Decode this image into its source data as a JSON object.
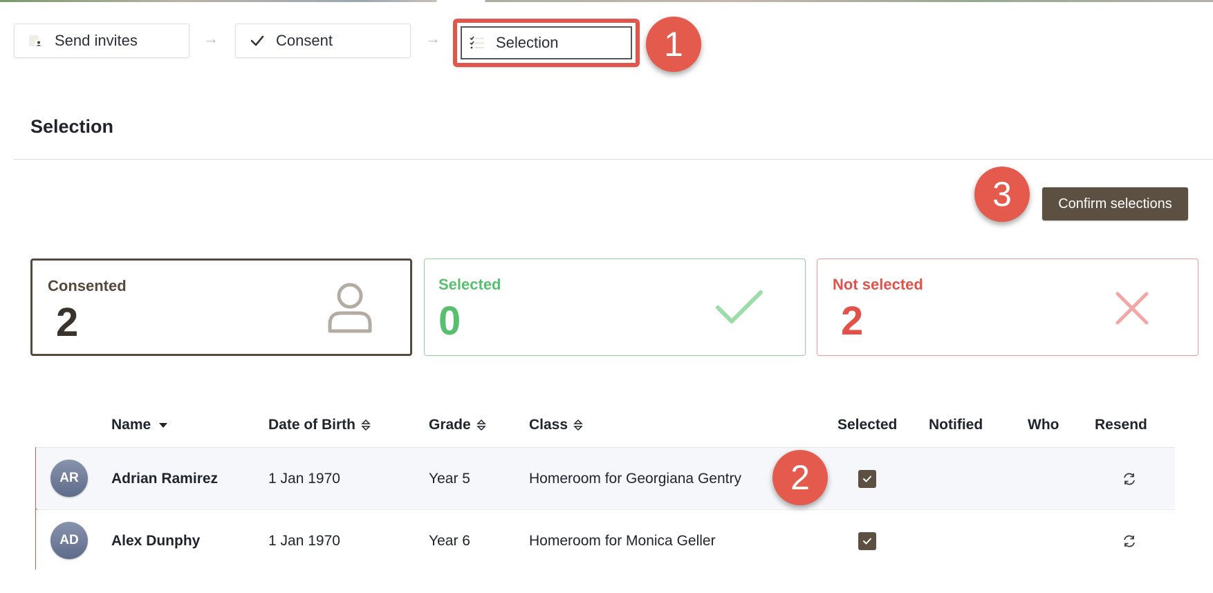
{
  "stepper": {
    "steps": [
      {
        "label": "Send invites",
        "icon": "person-badge-icon"
      },
      {
        "label": "Consent",
        "icon": "checkmark-icon"
      },
      {
        "label": "Selection",
        "icon": "checklist-icon",
        "active": true
      }
    ]
  },
  "callouts": [
    "1",
    "2",
    "3"
  ],
  "page": {
    "title": "Selection",
    "confirm_button": "Confirm selections"
  },
  "summary": {
    "consented": {
      "label": "Consented",
      "value": "2",
      "icon": "person-icon"
    },
    "selected": {
      "label": "Selected",
      "value": "0",
      "icon": "checkmark-icon"
    },
    "not_selected": {
      "label": "Not selected",
      "value": "2",
      "icon": "close-icon"
    }
  },
  "table": {
    "columns": [
      "Name",
      "Date of Birth",
      "Grade",
      "Class",
      "Selected",
      "Notified",
      "Who",
      "Resend"
    ],
    "rows": [
      {
        "initials": "AR",
        "name": "Adrian Ramirez",
        "dob": "1 Jan 1970",
        "grade": "Year 5",
        "class": "Homeroom for Georgiana Gentry",
        "selected": true
      },
      {
        "initials": "AD",
        "name": "Alex Dunphy",
        "dob": "1 Jan 1970",
        "grade": "Year 6",
        "class": "Homeroom for Monica Geller",
        "selected": true
      }
    ]
  },
  "colors": {
    "brand_brown": "#5b5042",
    "success_green": "#58bf6f",
    "danger_red": "#e0524a",
    "callout_red": "#e45a4c"
  }
}
